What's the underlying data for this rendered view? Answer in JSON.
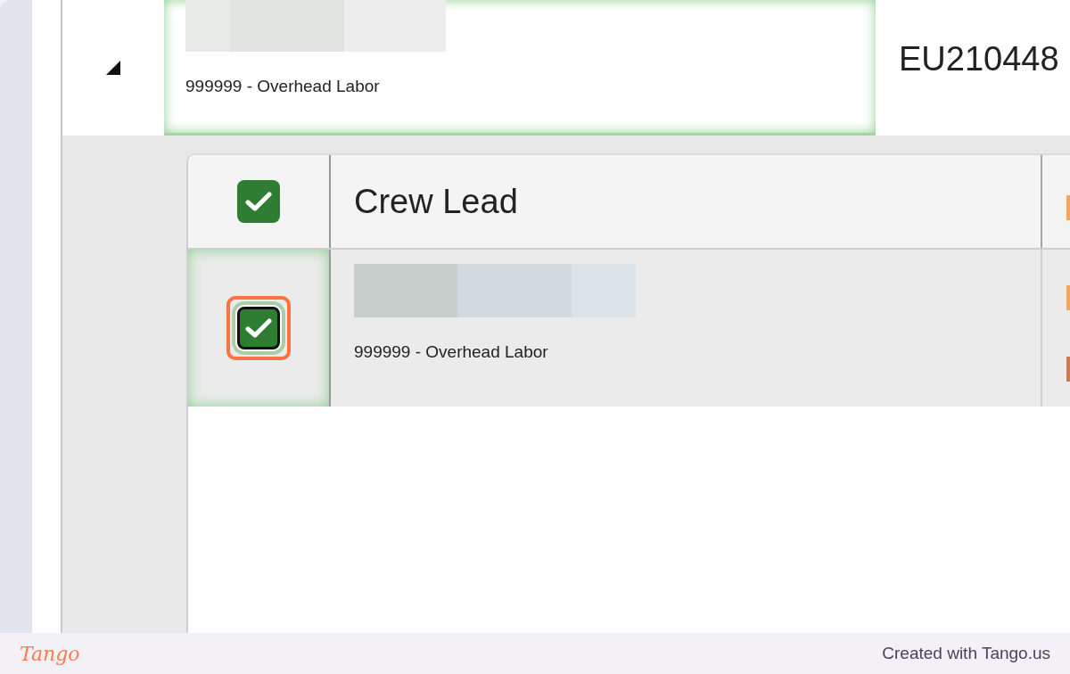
{
  "parent_row": {
    "expanded": true,
    "selected": true,
    "employee_code": "999999 - Overhead Labor",
    "column_3": "EU210448"
  },
  "crew_table": {
    "header": {
      "checked": true,
      "label": "Crew Lead"
    },
    "rows": [
      {
        "checked": true,
        "focused": true,
        "employee_code": "999999 - Overhead Labor"
      }
    ]
  },
  "footer": {
    "logo": "Tango",
    "credit": "Created with Tango.us"
  }
}
